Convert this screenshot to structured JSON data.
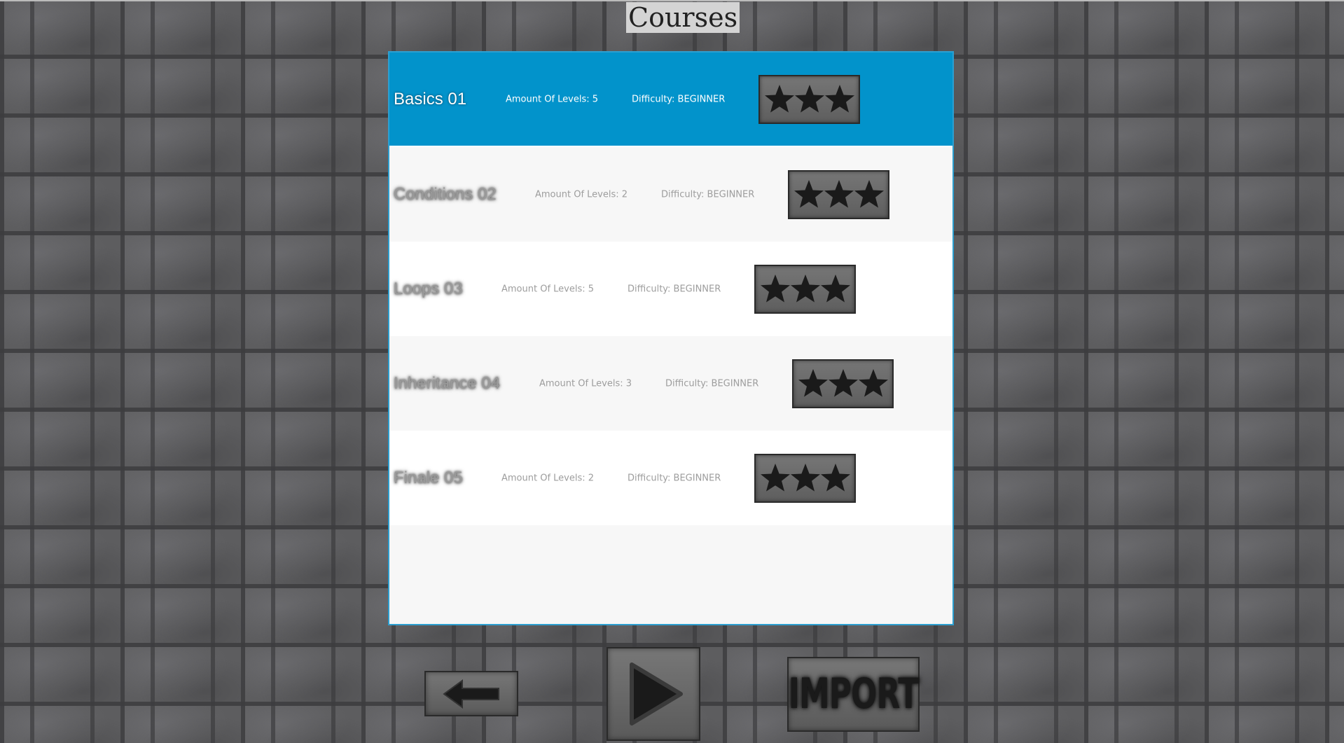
{
  "window": {
    "title": "Courses"
  },
  "courses": [
    {
      "name": "Basics 01",
      "levels": "Amount Of Levels: 5",
      "difficulty": "Difficulty: BEGINNER",
      "stars": 3,
      "selected": true
    },
    {
      "name": "Conditions 02",
      "levels": "Amount Of Levels: 2",
      "difficulty": "Difficulty: BEGINNER",
      "stars": 3,
      "selected": false
    },
    {
      "name": "Loops 03",
      "levels": "Amount Of Levels: 5",
      "difficulty": "Difficulty: BEGINNER",
      "stars": 3,
      "selected": false
    },
    {
      "name": "Inheritance 04",
      "levels": "Amount Of Levels: 3",
      "difficulty": "Difficulty: BEGINNER",
      "stars": 3,
      "selected": false
    },
    {
      "name": "Finale 05",
      "levels": "Amount Of Levels: 2",
      "difficulty": "Difficulty: BEGINNER",
      "stars": 3,
      "selected": false
    }
  ],
  "buttons": {
    "back_icon": "arrow-left-icon",
    "play_icon": "play-icon",
    "import_label": "IMPORT"
  },
  "colors": {
    "selection": "#0293cb",
    "panel_border": "#2d9fd0",
    "star": "#1a1a1a"
  }
}
